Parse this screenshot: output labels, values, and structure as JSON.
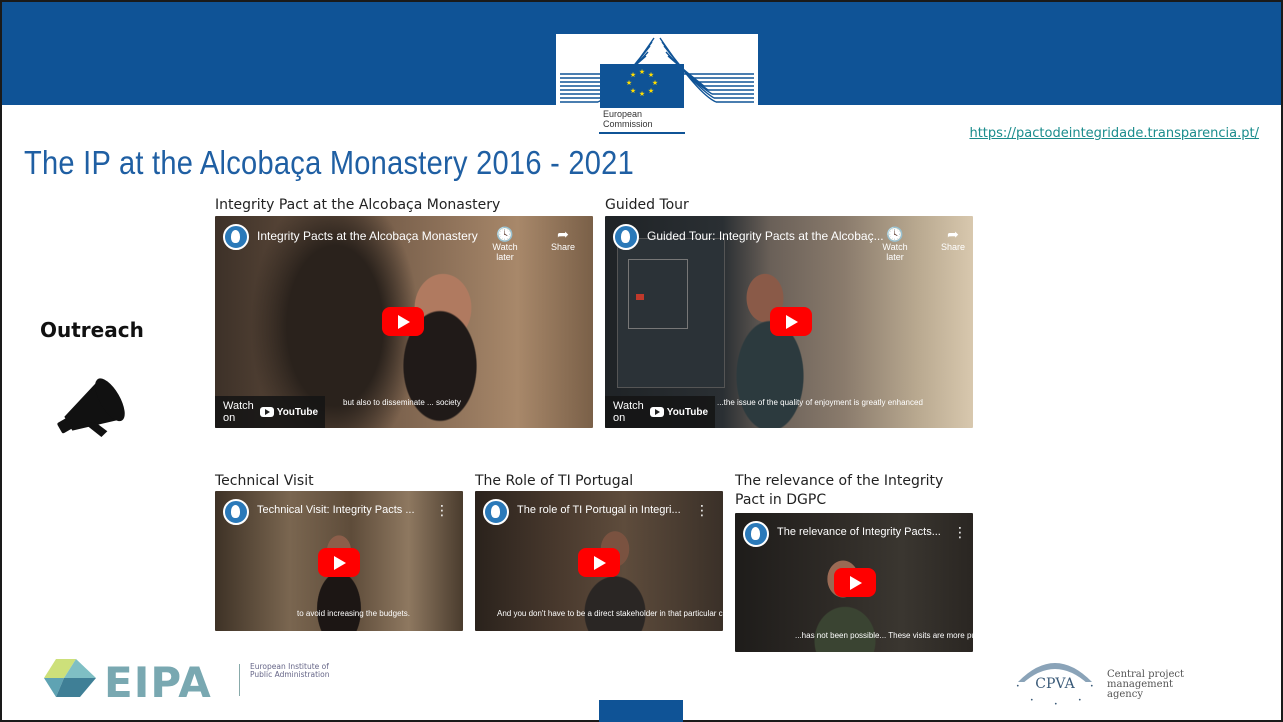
{
  "header": {
    "ec_logo_line1": "European",
    "ec_logo_line2": "Commission",
    "url": "https://pactodeintegridade.transparencia.pt/",
    "title": "The IP at the Alcobaça Monastery 2016 - 2021"
  },
  "sidebar": {
    "label": "Outreach",
    "icon": "megaphone-icon"
  },
  "videos": [
    {
      "caption": "Integrity Pact at the Alcobaça Monastery",
      "title": "Integrity Pacts at the Alcobaça Monastery",
      "subtitle": "but also to disseminate ... society",
      "watch_later": "Watch later",
      "share": "Share",
      "watch_on": "Watch on",
      "youtube": "YouTube"
    },
    {
      "caption": "Guided Tour",
      "title": "Guided Tour: Integrity Pacts at the Alcobaç...",
      "subtitle": "...the issue of the quality of enjoyment is greatly enhanced",
      "watch_later": "Watch later",
      "share": "Share",
      "watch_on": "Watch on",
      "youtube": "YouTube"
    },
    {
      "caption": "Technical Visit",
      "title": "Technical Visit: Integrity Pacts ...",
      "subtitle": "to avoid increasing the budgets."
    },
    {
      "caption": "The Role of TI Portugal",
      "title": "The role of TI Portugal in Integri...",
      "subtitle": "And you don't have to be a direct stakeholder in that particular contract."
    },
    {
      "caption": "The relevance of the Integrity Pact in DGPC",
      "title": "The relevance of Integrity Pacts...",
      "subtitle": "...has not been possible... These visits are more punctual."
    }
  ],
  "footer": {
    "eipa_word": "EIPA",
    "eipa_sub": "European Institute of Public Administration",
    "cpva_word": "CPVA",
    "cpva_sub": "Central project management agency"
  },
  "colors": {
    "brand_blue": "#0f5396",
    "title_blue": "#1f5fa3",
    "link_teal": "#1a8c8c",
    "youtube_red": "#ff0000"
  }
}
